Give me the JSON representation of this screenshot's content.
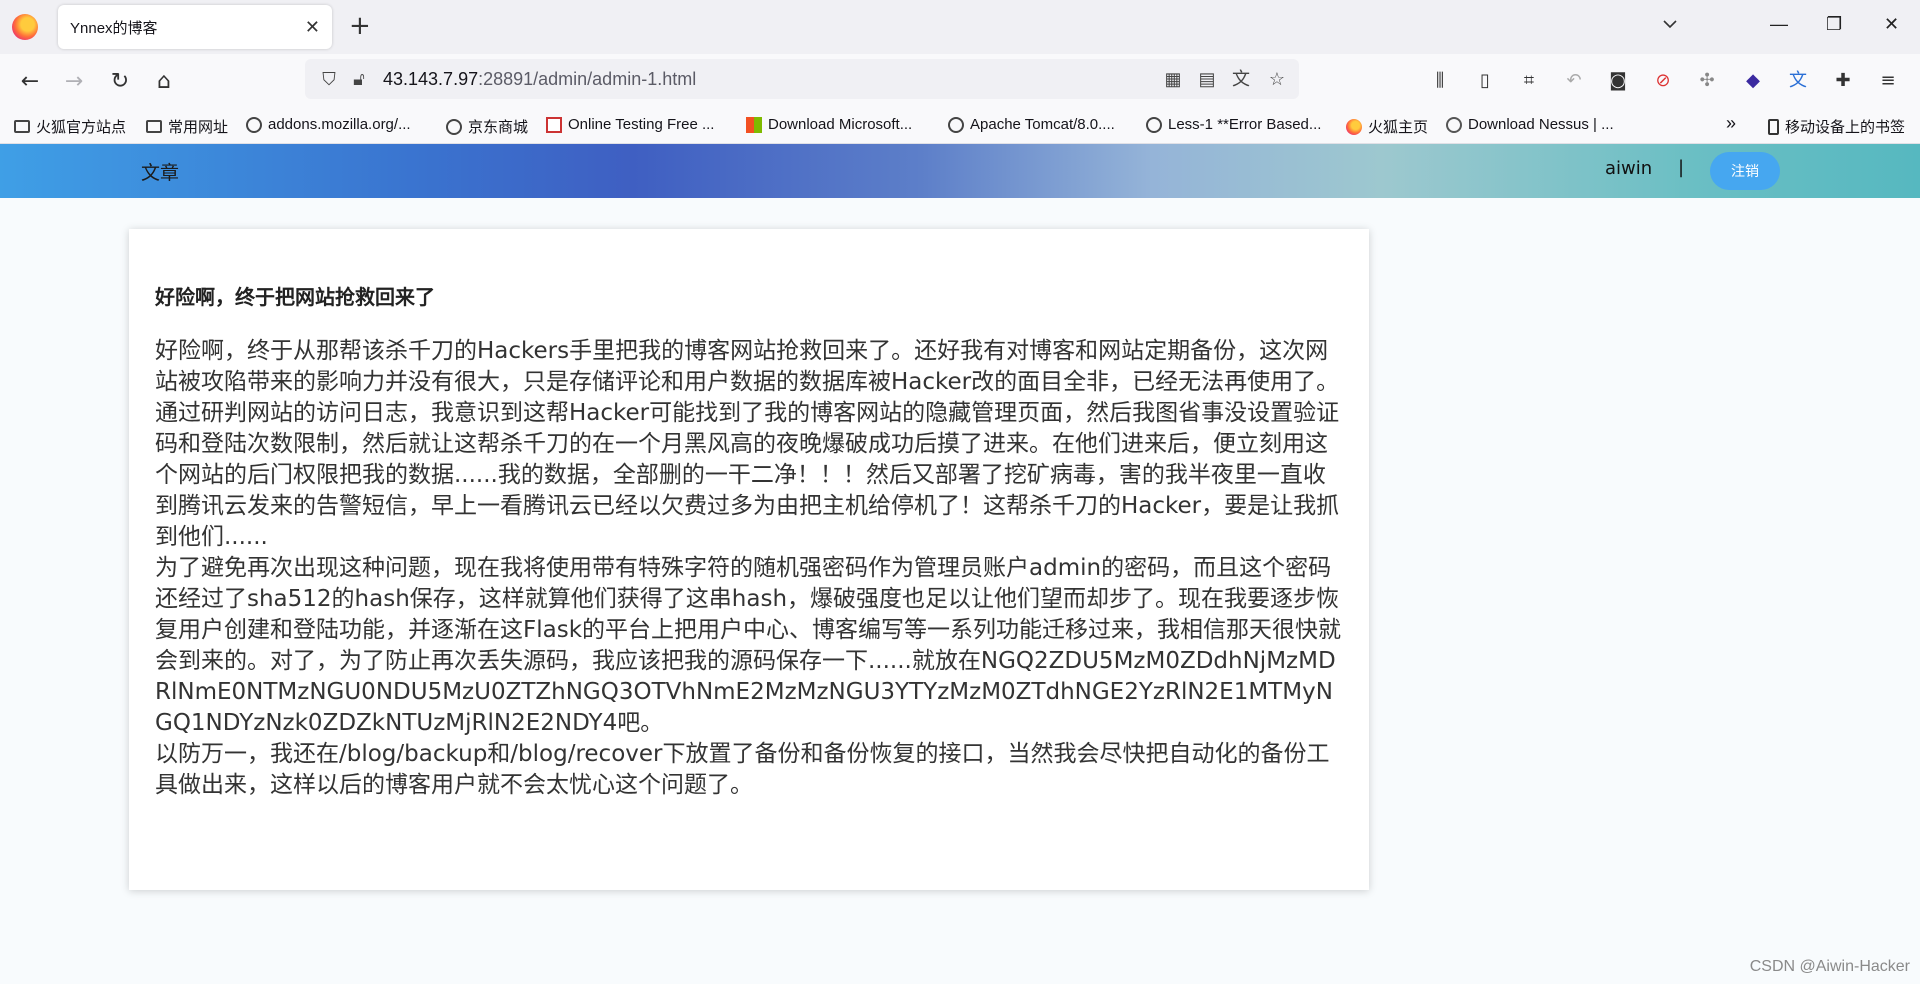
{
  "browser": {
    "tab_title": "Ynnex的博客",
    "tab_close": "✕",
    "new_tab": "+",
    "url_host": "43.143.7.97",
    "url_rest": ":28891/admin/admin-1.html",
    "bookmarks": [
      {
        "label": "火狐官方站点",
        "icon": "folder-icon"
      },
      {
        "label": "常用网址",
        "icon": "folder-icon"
      },
      {
        "label": "addons.mozilla.org/...",
        "icon": "globe-icon"
      },
      {
        "label": "京东商城",
        "icon": "globe-icon"
      },
      {
        "label": "Online Testing Free ...",
        "icon": "checkbox-icon"
      },
      {
        "label": "Download Microsoft...",
        "icon": "microsoft-icon"
      },
      {
        "label": "Apache Tomcat/8.0....",
        "icon": "globe-icon"
      },
      {
        "label": "Less-1 **Error Based...",
        "icon": "globe-icon"
      },
      {
        "label": "火狐主页",
        "icon": "firefox-icon"
      },
      {
        "label": "Download Nessus | ...",
        "icon": "nessus-icon"
      }
    ],
    "bookmarks_overflow": "»",
    "mobile_bookmarks": "移动设备上的书签"
  },
  "site": {
    "nav_article": "文章",
    "username": "aiwin",
    "separator": "|",
    "logout": "注销"
  },
  "article": {
    "title": "好险啊，终于把网站抢救回来了",
    "paragraphs": [
      "好险啊，终于从那帮该杀千刀的Hackers手里把我的博客网站抢救回来了。还好我有对博客和网站定期备份，这次网站被攻陷带来的影响力并没有很大，只是存储评论和用户数据的数据库被Hacker改的面目全非，已经无法再使用了。",
      "通过研判网站的访问日志，我意识到这帮Hacker可能找到了我的博客网站的隐藏管理页面，然后我图省事没设置验证码和登陆次数限制，然后就让这帮杀千刀的在一个月黑风高的夜晚爆破成功后摸了进来。在他们进来后，便立刻用这个网站的后门权限把我的数据......我的数据，全部删的一干二净！！！然后又部署了挖矿病毒，害的我半夜里一直收到腾讯云发来的告警短信，早上一看腾讯云已经以欠费过多为由把主机给停机了！这帮杀千刀的Hacker，要是让我抓到他们......",
      "为了避免再次出现这种问题，现在我将使用带有特殊字符的随机强密码作为管理员账户admin的密码，而且这个密码还经过了sha512的hash保存，这样就算他们获得了这串hash，爆破强度也足以让他们望而却步了。现在我要逐步恢复用户创建和登陆功能，并逐渐在这Flask的平台上把用户中心、博客编写等一系列功能迁移过来，我相信那天很快就会到来的。对了，为了防止再次丢失源码，我应该把我的源码保存一下......就放在NGQ2ZDU5MzM0ZDdhNjMzMDRlNmE0NTMzNGU0NDU5MzU0ZTZhNGQ3OTVhNmE2MzMzNGU3YTYzMzM0ZTdhNGE2YzRlN2E1MTMyNGQ1NDYzNzk0ZDZkNTUzMjRlN2E2NDY4吧。",
      "以防万一，我还在/blog/backup和/blog/recover下放置了备份和备份恢复的接口，当然我会尽快把自动化的备份工具做出来，这样以后的博客用户就不会太忧心这个问题了。"
    ]
  },
  "watermark": "CSDN @Aiwin-Hacker"
}
